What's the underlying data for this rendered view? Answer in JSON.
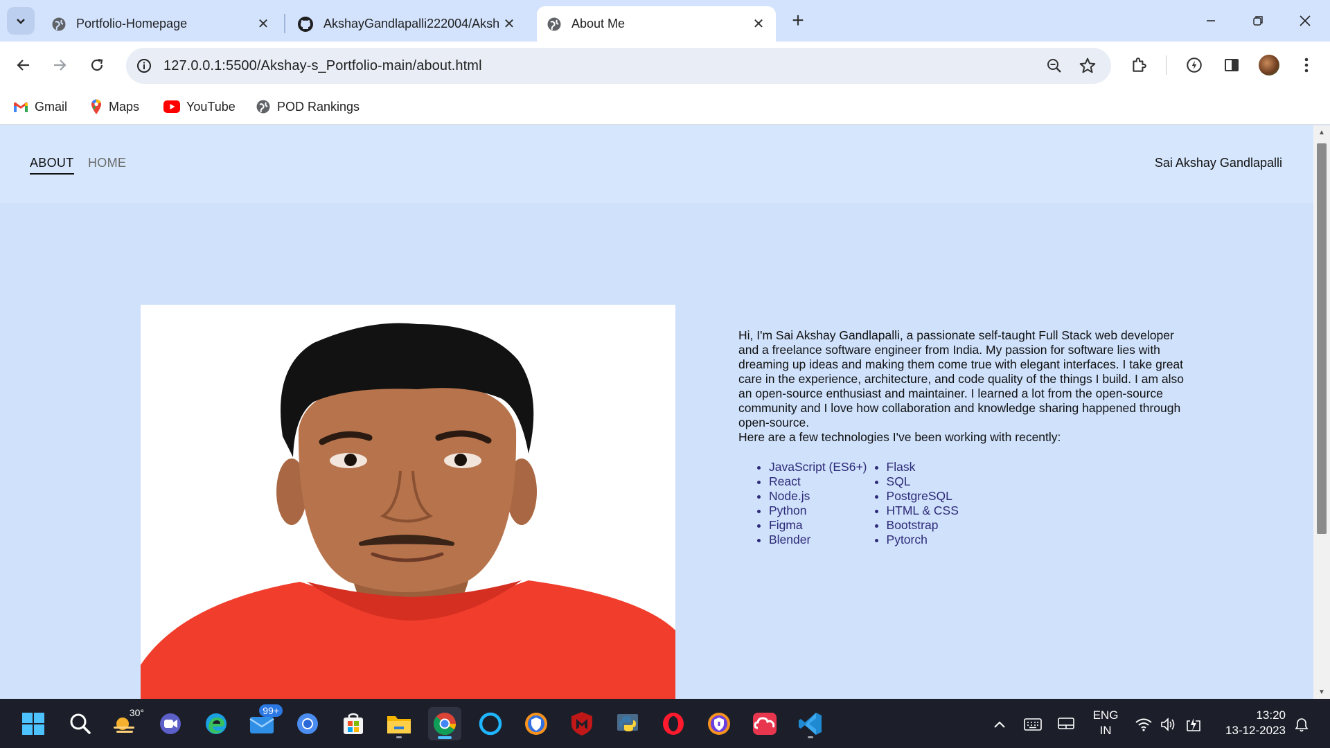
{
  "browser": {
    "tabs": [
      {
        "title": "Portfolio-Homepage",
        "icon": "globe-icon",
        "active": false
      },
      {
        "title": "AkshayGandlapalli222004/Aksh",
        "icon": "github-icon",
        "active": false
      },
      {
        "title": "About Me",
        "icon": "globe-icon",
        "active": true
      }
    ],
    "url": "127.0.0.1:5500/Akshay-s_Portfolio-main/about.html",
    "bookmarks": [
      {
        "label": "Gmail",
        "icon": "gmail-icon"
      },
      {
        "label": "Maps",
        "icon": "maps-icon"
      },
      {
        "label": "YouTube",
        "icon": "youtube-icon"
      },
      {
        "label": "POD Rankings",
        "icon": "globe-icon"
      }
    ]
  },
  "page": {
    "nav": {
      "about": "ABOUT",
      "home": "HOME"
    },
    "site_name": "Sai Akshay Gandlapalli",
    "about_text": "Hi, I'm Sai Akshay Gandlapalli, a passionate self-taught Full Stack web developer and a freelance software engineer from India. My passion for software lies with dreaming up ideas and making them come true with elegant interfaces. I take great care in the experience, architecture, and code quality of the things I build. I am also an open-source enthusiast and maintainer. I learned a lot from the open-source community and I love how collaboration and knowledge sharing happened through open-source.",
    "tech_intro": "Here are a few technologies I've been working with recently:",
    "tech_left": [
      "JavaScript (ES6+)",
      "React",
      "Node.js",
      "Python",
      "Figma",
      "Blender"
    ],
    "tech_right": [
      "Flask",
      "SQL",
      "PostgreSQL",
      "HTML & CSS",
      "Bootstrap",
      "Pytorch"
    ]
  },
  "taskbar": {
    "weather_temp": "30°",
    "mail_badge": "99+",
    "lang_line1": "ENG",
    "lang_line2": "IN",
    "time": "13:20",
    "date": "13-12-2023"
  },
  "colors": {
    "page_bg": "#cfe1fb",
    "header_bg": "#d6e7fd",
    "list_text": "#2e2a78",
    "taskbar_bg": "#1c1f29"
  }
}
